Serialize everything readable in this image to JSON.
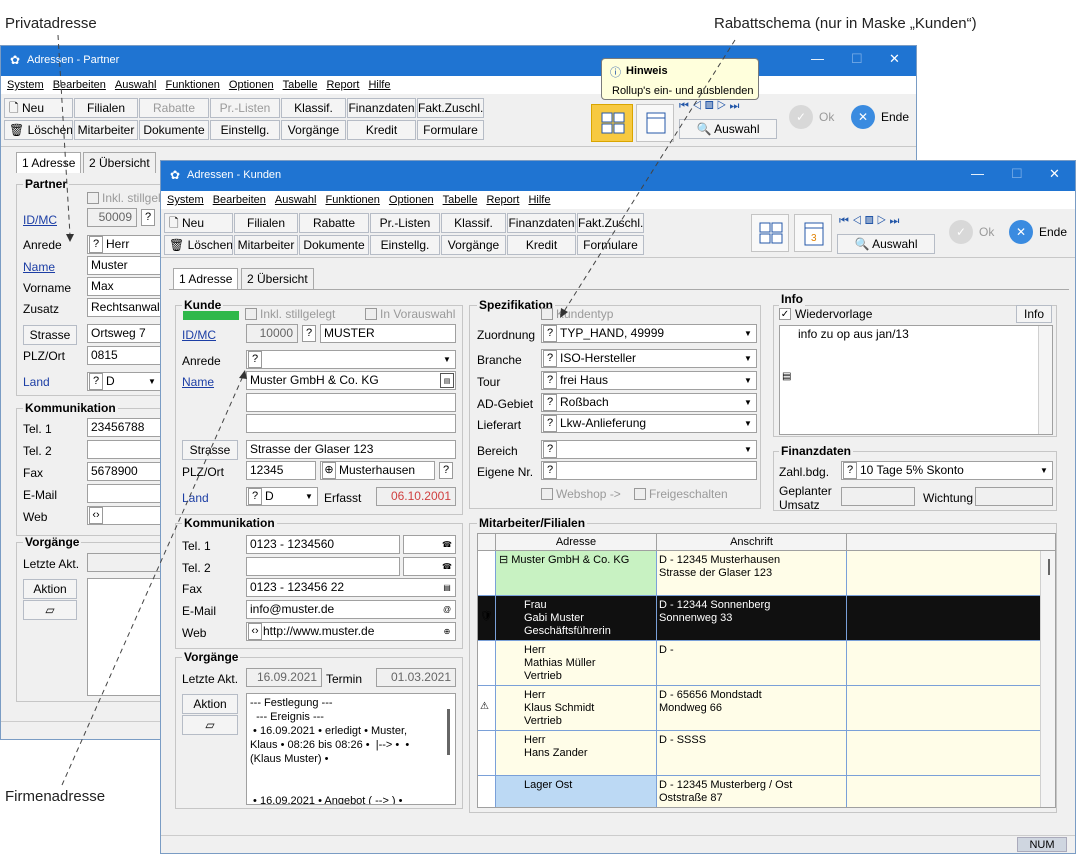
{
  "annotations": {
    "privat": "Privatadresse",
    "rabatt": "Rabattschema (nur in Maske „Kunden“)",
    "firmen": "Firmenadresse"
  },
  "back": {
    "title": "Adressen - Partner",
    "menu": [
      "System",
      "Bearbeiten",
      "Auswahl",
      "Funktionen",
      "Optionen",
      "Tabelle",
      "Report",
      "Hilfe"
    ],
    "tb1": [
      "Neu",
      "Filialen",
      "Rabatte",
      "Pr.-Listen",
      "Klassif.",
      "Finanzdaten",
      "Fakt.Zuschl."
    ],
    "tb2": [
      "Löschen",
      "Mitarbeiter",
      "Dokumente",
      "Einstellg.",
      "Vorgänge",
      "Kredit",
      "Formulare"
    ],
    "auswahl": "Auswahl",
    "ok": "Ok",
    "ende": "Ende",
    "tooltip": {
      "title": "Hinweis",
      "text": "Rollup's ein- und ausblenden"
    },
    "tabs": [
      "1 Adresse",
      "2 Übersicht"
    ],
    "partner": {
      "title": "Partner",
      "inkl": "Inkl. stillgel",
      "idmc_label": "ID/MC",
      "id": "50009",
      "anrede_label": "Anrede",
      "anrede": "Herr",
      "name_label": "Name",
      "name": "Muster",
      "vorname_label": "Vorname",
      "vorname": "Max",
      "zusatz_label": "Zusatz",
      "zusatz": "Rechtsanwalt",
      "strasse_btn": "Strasse",
      "strasse": "Ortsweg 7",
      "plz_label": "PLZ/Ort",
      "plz": "0815",
      "land_label": "Land",
      "land": "D"
    },
    "komm": {
      "title": "Kommunikation",
      "tel1_label": "Tel. 1",
      "tel1": "23456788",
      "tel2_label": "Tel. 2",
      "fax_label": "Fax",
      "fax": "5678900",
      "email_label": "E-Mail",
      "web_label": "Web"
    },
    "vorg": {
      "title": "Vorgänge",
      "letzte": "Letzte Akt.",
      "aktion": "Aktion"
    }
  },
  "front": {
    "title": "Adressen - Kunden",
    "menu": [
      "System",
      "Bearbeiten",
      "Auswahl",
      "Funktionen",
      "Optionen",
      "Tabelle",
      "Report",
      "Hilfe"
    ],
    "tb1": [
      "Neu",
      "Filialen",
      "Rabatte",
      "Pr.-Listen",
      "Klassif.",
      "Finanzdaten",
      "Fakt.Zuschl."
    ],
    "tb2": [
      "Löschen",
      "Mitarbeiter",
      "Dokumente",
      "Einstellg.",
      "Vorgänge",
      "Kredit",
      "Formulare"
    ],
    "auswahl": "Auswahl",
    "ok": "Ok",
    "ende": "Ende",
    "cal_num": "3",
    "tabs": [
      "1 Adresse",
      "2 Übersicht"
    ],
    "kunde": {
      "title": "Kunde",
      "inkl": "Inkl. stillgelegt",
      "vorauswahl": "In Vorauswahl",
      "idmc_label": "ID/MC",
      "id": "10000",
      "mc": "MUSTER",
      "anrede_label": "Anrede",
      "anrede": "",
      "name_label": "Name",
      "name": "Muster GmbH & Co. KG",
      "strasse_btn": "Strasse",
      "strasse": "Strasse der Glaser 123",
      "plz_label": "PLZ/Ort",
      "plz": "12345",
      "ort": "Musterhausen",
      "land_label": "Land",
      "land": "D",
      "erfasst_label": "Erfasst",
      "erfasst": "06.10.2001"
    },
    "komm": {
      "title": "Kommunikation",
      "tel1_label": "Tel. 1",
      "tel1": "0123 - 1234560",
      "tel2_label": "Tel. 2",
      "fax_label": "Fax",
      "fax": "0123 - 123456 22",
      "email_label": "E-Mail",
      "email": "info@muster.de",
      "web_label": "Web",
      "web": "http://www.muster.de"
    },
    "vorg": {
      "title": "Vorgänge",
      "letzte_label": "Letzte Akt.",
      "letzte": "16.09.2021",
      "termin_label": "Termin",
      "termin": "01.03.2021",
      "aktion": "Aktion",
      "notes": "--- Festlegung ---\n  --- Ereignis ---\n • 16.09.2021 • erledigt • Muster,\nKlaus • 08:26 bis 08:26 •  |--> •  •\n(Klaus Muster) •\n\n\n • 16.09.2021 • Angebot ( --> ) •"
    },
    "spez": {
      "title": "Spezifikation",
      "kundentyp": "Kundentyp",
      "zuord_label": "Zuordnung",
      "zuord": "TYP_HAND, 49999",
      "branche_label": "Branche",
      "branche": "ISO-Hersteller",
      "tour_label": "Tour",
      "tour": "frei Haus",
      "ad_label": "AD-Gebiet",
      "ad": "Roßbach",
      "lief_label": "Lieferart",
      "lief": "Lkw-Anlieferung",
      "bereich_label": "Bereich",
      "eigene_label": "Eigene Nr.",
      "webshop": "Webshop ->",
      "freischalten": "Freigeschalten"
    },
    "info": {
      "title": "Info",
      "wv": "Wiedervorlage",
      "btn": "Info",
      "text": "info zu op aus jan/13"
    },
    "fin": {
      "title": "Finanzdaten",
      "zahl_label": "Zahl.bdg.",
      "zahl": "10 Tage 5% Skonto",
      "umsatz_label1": "Geplanter",
      "umsatz_label2": "Umsatz",
      "wichtung_label": "Wichtung"
    },
    "mf": {
      "title": "Mitarbeiter/Filialen",
      "col_adresse": "Adresse",
      "col_anschrift": "Anschrift",
      "rows": [
        {
          "adresse": "⊟ Muster GmbH & Co. KG",
          "anschrift": "D - 12345 Musterhausen\nStrasse der Glaser 123"
        },
        {
          "adresse": "Frau\nGabi Muster\nGeschäftsführerin",
          "anschrift": "D - 12344 Sonnenberg\nSonnenweg 33"
        },
        {
          "adresse": "Herr\nMathias Müller\nVertrieb",
          "anschrift": "D -"
        },
        {
          "adresse": "Herr\nKlaus Schmidt\nVertrieb",
          "anschrift": "D - 65656 Mondstadt\nMondweg 66"
        },
        {
          "adresse": "Herr\nHans Zander",
          "anschrift": "D - SSSS"
        },
        {
          "adresse": "Lager Ost",
          "anschrift": "D - 12345 Musterberg / Ost\nOststraße 87"
        }
      ]
    },
    "status": "NUM"
  }
}
